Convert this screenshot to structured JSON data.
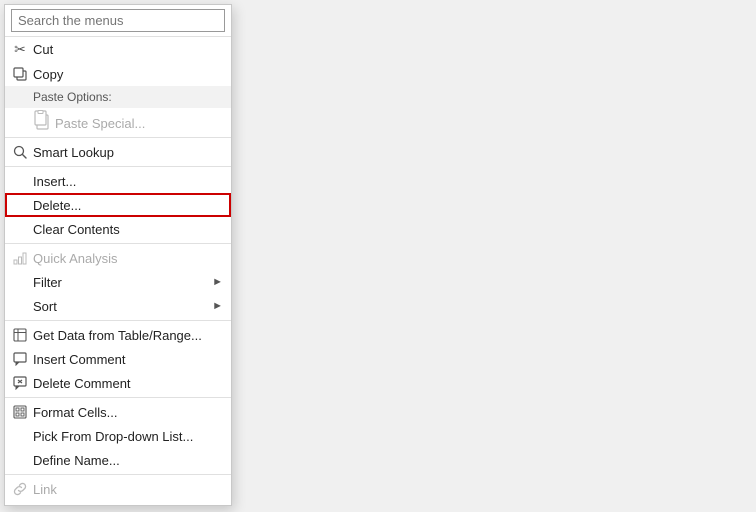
{
  "menu": {
    "search_placeholder": "Search the menus",
    "items": [
      {
        "id": "cut",
        "label": "Cut",
        "icon": "✂",
        "disabled": false,
        "has_arrow": false,
        "separator_after": false
      },
      {
        "id": "copy",
        "label": "Copy",
        "icon": "⧉",
        "disabled": false,
        "has_arrow": false,
        "separator_after": false
      },
      {
        "id": "paste-options",
        "label": "Paste Options:",
        "icon": "",
        "disabled": false,
        "has_arrow": false,
        "separator_after": false,
        "is_header": true
      },
      {
        "id": "paste-special",
        "label": "Paste Special...",
        "icon": "paste",
        "disabled": true,
        "has_arrow": false,
        "separator_after": true
      },
      {
        "id": "smart-lookup",
        "label": "Smart Lookup",
        "icon": "🔍",
        "disabled": false,
        "has_arrow": false,
        "separator_after": true
      },
      {
        "id": "insert",
        "label": "Insert...",
        "icon": "",
        "disabled": false,
        "has_arrow": false,
        "separator_after": false
      },
      {
        "id": "delete",
        "label": "Delete...",
        "icon": "",
        "disabled": false,
        "has_arrow": false,
        "separator_after": false,
        "highlighted": true
      },
      {
        "id": "clear-contents",
        "label": "Clear Contents",
        "icon": "",
        "disabled": false,
        "has_arrow": false,
        "separator_after": true
      },
      {
        "id": "quick-analysis",
        "label": "Quick Analysis",
        "icon": "⚡",
        "disabled": true,
        "has_arrow": false,
        "separator_after": false
      },
      {
        "id": "filter",
        "label": "Filter",
        "icon": "",
        "disabled": false,
        "has_arrow": true,
        "separator_after": false
      },
      {
        "id": "sort",
        "label": "Sort",
        "icon": "",
        "disabled": false,
        "has_arrow": true,
        "separator_after": true
      },
      {
        "id": "get-data",
        "label": "Get Data from Table/Range...",
        "icon": "⊞",
        "disabled": false,
        "has_arrow": false,
        "separator_after": false
      },
      {
        "id": "insert-comment",
        "label": "Insert Comment",
        "icon": "💬",
        "disabled": false,
        "has_arrow": false,
        "separator_after": false
      },
      {
        "id": "delete-comment",
        "label": "Delete Comment",
        "icon": "✎",
        "disabled": false,
        "has_arrow": false,
        "separator_after": true
      },
      {
        "id": "format-cells",
        "label": "Format Cells...",
        "icon": "⊞",
        "disabled": false,
        "has_arrow": false,
        "separator_after": false
      },
      {
        "id": "pick-dropdown",
        "label": "Pick From Drop-down List...",
        "icon": "",
        "disabled": false,
        "has_arrow": false,
        "separator_after": false
      },
      {
        "id": "define-name",
        "label": "Define Name...",
        "icon": "",
        "disabled": false,
        "has_arrow": false,
        "separator_after": true
      },
      {
        "id": "link",
        "label": "Link",
        "icon": "🔗",
        "disabled": true,
        "has_arrow": false,
        "separator_after": false
      }
    ]
  }
}
